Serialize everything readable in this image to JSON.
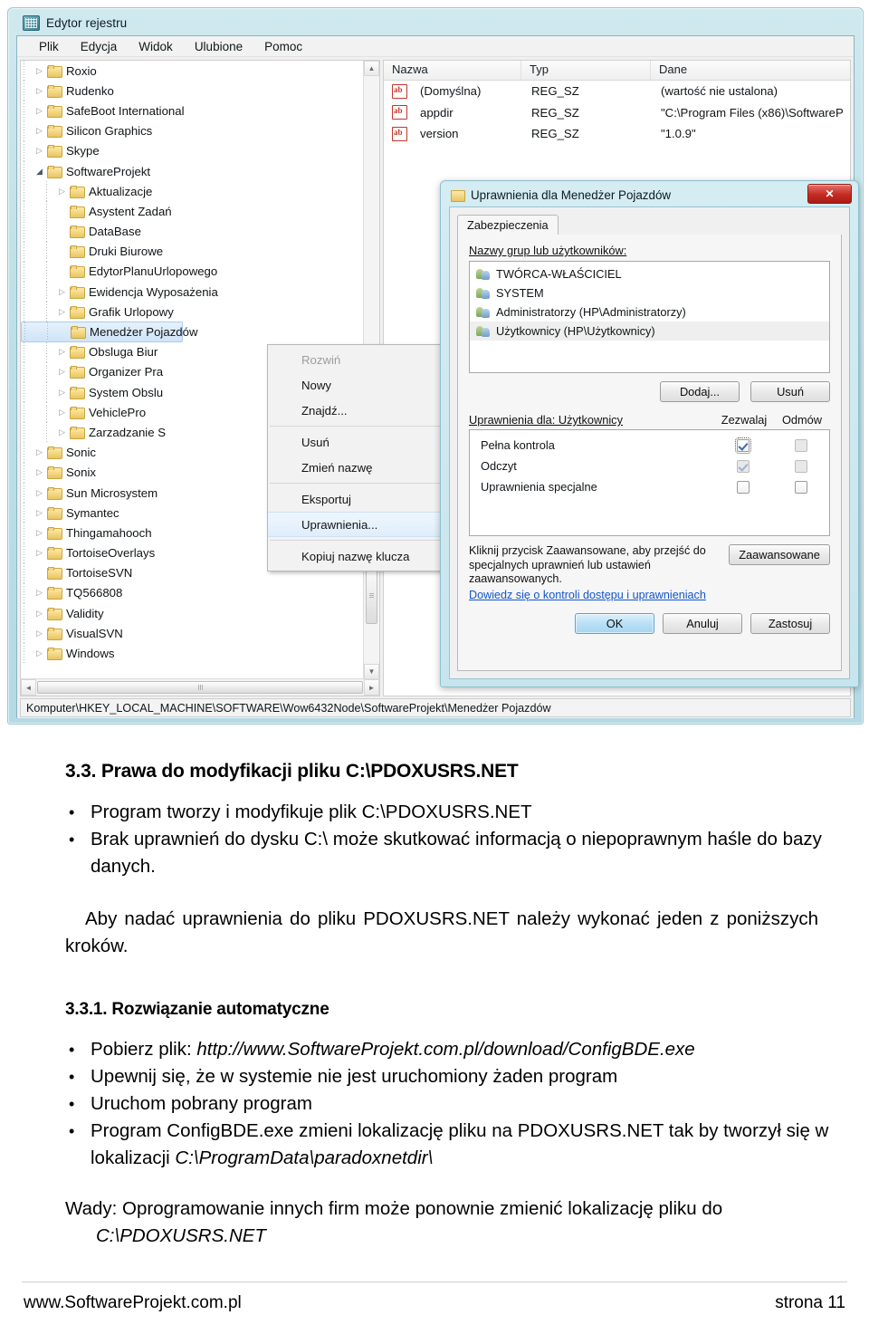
{
  "screenshot": {
    "window": {
      "title": "Edytor rejestru",
      "icon": "registry-editor-icon",
      "menus": [
        "Plik",
        "Edycja",
        "Widok",
        "Ulubione",
        "Pomoc"
      ],
      "statusbar": "Komputer\\HKEY_LOCAL_MACHINE\\SOFTWARE\\Wow6432Node\\SoftwareProjekt\\Menedżer Pojazdów"
    },
    "tree": [
      {
        "label": "Roxio",
        "indent": 1,
        "arrow": "collapsed"
      },
      {
        "label": "Rudenko",
        "indent": 1,
        "arrow": "collapsed"
      },
      {
        "label": "SafeBoot International",
        "indent": 1,
        "arrow": "collapsed"
      },
      {
        "label": "Silicon Graphics",
        "indent": 1,
        "arrow": "collapsed"
      },
      {
        "label": "Skype",
        "indent": 1,
        "arrow": "collapsed"
      },
      {
        "label": "SoftwareProjekt",
        "indent": 1,
        "arrow": "expanded"
      },
      {
        "label": "Aktualizacje",
        "indent": 2,
        "arrow": "collapsed"
      },
      {
        "label": "Asystent Zadań",
        "indent": 2,
        "arrow": "none"
      },
      {
        "label": "DataBase",
        "indent": 2,
        "arrow": "none"
      },
      {
        "label": "Druki Biurowe",
        "indent": 2,
        "arrow": "none"
      },
      {
        "label": "EdytorPlanuUrlopowego",
        "indent": 2,
        "arrow": "none"
      },
      {
        "label": "Ewidencja Wyposażenia",
        "indent": 2,
        "arrow": "collapsed"
      },
      {
        "label": "Grafik Urlopowy",
        "indent": 2,
        "arrow": "collapsed"
      },
      {
        "label": "Menedżer Pojazdów",
        "indent": 2,
        "arrow": "none",
        "selected": true
      },
      {
        "label": "Obsluga Biur",
        "indent": 2,
        "arrow": "collapsed"
      },
      {
        "label": "Organizer Pra",
        "indent": 2,
        "arrow": "collapsed"
      },
      {
        "label": "System Obslu",
        "indent": 2,
        "arrow": "collapsed"
      },
      {
        "label": "VehiclePro",
        "indent": 2,
        "arrow": "collapsed"
      },
      {
        "label": "Zarzadzanie S",
        "indent": 2,
        "arrow": "collapsed"
      },
      {
        "label": "Sonic",
        "indent": 1,
        "arrow": "collapsed"
      },
      {
        "label": "Sonix",
        "indent": 1,
        "arrow": "collapsed"
      },
      {
        "label": "Sun Microsystem",
        "indent": 1,
        "arrow": "collapsed"
      },
      {
        "label": "Symantec",
        "indent": 1,
        "arrow": "collapsed"
      },
      {
        "label": "Thingamahooch",
        "indent": 1,
        "arrow": "collapsed"
      },
      {
        "label": "TortoiseOverlays",
        "indent": 1,
        "arrow": "collapsed"
      },
      {
        "label": "TortoiseSVN",
        "indent": 1,
        "arrow": "none"
      },
      {
        "label": "TQ566808",
        "indent": 1,
        "arrow": "collapsed"
      },
      {
        "label": "Validity",
        "indent": 1,
        "arrow": "collapsed"
      },
      {
        "label": "VisualSVN",
        "indent": 1,
        "arrow": "collapsed"
      },
      {
        "label": "Windows",
        "indent": 1,
        "arrow": "collapsed"
      }
    ],
    "values_list": {
      "columns": [
        "Nazwa",
        "Typ",
        "Dane"
      ],
      "rows": [
        {
          "name": "(Domyślna)",
          "type": "REG_SZ",
          "data": "(wartość nie ustalona)"
        },
        {
          "name": "appdir",
          "type": "REG_SZ",
          "data": "\"C:\\Program Files (x86)\\SoftwareP"
        },
        {
          "name": "version",
          "type": "REG_SZ",
          "data": "\"1.0.9\""
        }
      ]
    },
    "context_menu": [
      {
        "label": "Rozwiń",
        "state": "disabled"
      },
      {
        "label": "Nowy",
        "state": "normal"
      },
      {
        "label": "Znajdź...",
        "state": "normal"
      },
      {
        "separator": true
      },
      {
        "label": "Usuń",
        "state": "normal"
      },
      {
        "label": "Zmień nazwę",
        "state": "normal"
      },
      {
        "separator": true
      },
      {
        "label": "Eksportuj",
        "state": "normal"
      },
      {
        "label": "Uprawnienia...",
        "state": "highlighted"
      },
      {
        "separator": true
      },
      {
        "label": "Kopiuj nazwę klucza",
        "state": "normal"
      }
    ],
    "dialog": {
      "title": "Uprawnienia dla Menedżer Pojazdów",
      "close_label": "✕",
      "tab": "Zabezpieczenia",
      "groups_label": "Nazwy grup lub użytkowników:",
      "groups": [
        {
          "name": "TWÓRCA-WŁAŚCICIEL",
          "selected": false
        },
        {
          "name": "SYSTEM",
          "selected": false
        },
        {
          "name": "Administratorzy (HP\\Administratorzy)",
          "selected": false
        },
        {
          "name": "Użytkownicy (HP\\Użytkownicy)",
          "selected": true
        }
      ],
      "add_button": "Dodaj...",
      "remove_button": "Usuń",
      "perm_label": "Uprawnienia dla: Użytkownicy",
      "col_allow": "Zezwalaj",
      "col_deny": "Odmów",
      "permissions": [
        {
          "name": "Pełna kontrola",
          "allow": "checked-focus",
          "deny": "gray"
        },
        {
          "name": "Odczyt",
          "allow": "checked-dim",
          "deny": "gray"
        },
        {
          "name": "Uprawnienia specjalne",
          "allow": "empty",
          "deny": "empty"
        }
      ],
      "hint_text": "Kliknij przycisk Zaawansowane, aby przejść do specjalnych uprawnień lub ustawień zaawansowanych.",
      "hint_link": "Dowiedz się o kontroli dostępu i uprawnieniach",
      "advanced_button": "Zaawansowane",
      "ok_button": "OK",
      "cancel_button": "Anuluj",
      "apply_button": "Zastosuj"
    }
  },
  "document": {
    "heading": "3.3. Prawa do modyfikacji pliku C:\\PDOXUSRS.NET",
    "bullets_1": [
      "Program tworzy i modyfikuje plik C:\\PDOXUSRS.NET",
      "Brak uprawnień do dysku C:\\ może skutkować informacją o niepoprawnym haśle do bazy danych."
    ],
    "paragraph_1": "Aby nadać uprawnienia do pliku PDOXUSRS.NET należy wykonać jeden z poniższych kroków.",
    "subheading": "3.3.1. Rozwiązanie automatyczne",
    "bullet_download_prefix": "Pobierz plik: ",
    "bullet_download_url": "http://www.SoftwareProjekt.com.pl/download/ConfigBDE.exe",
    "bullets_2": [
      "Upewnij się, że w systemie nie jest uruchomiony żaden program",
      "Uruchom pobrany program"
    ],
    "bullet_configbde_a": "Program ConfigBDE.exe zmieni lokalizację pliku na PDOXUSRS.NET tak by tworzył się w lokalizacji ",
    "bullet_configbde_path": "C:\\ProgramData\\paradoxnetdir\\",
    "wady_text": "Wady: Oprogramowanie innych firm może ponownie zmienić lokalizację pliku do ",
    "wady_path": "C:\\PDOXUSRS.NET",
    "footer_left": "www.SoftwareProjekt.com.pl",
    "footer_right": "strona 11"
  }
}
